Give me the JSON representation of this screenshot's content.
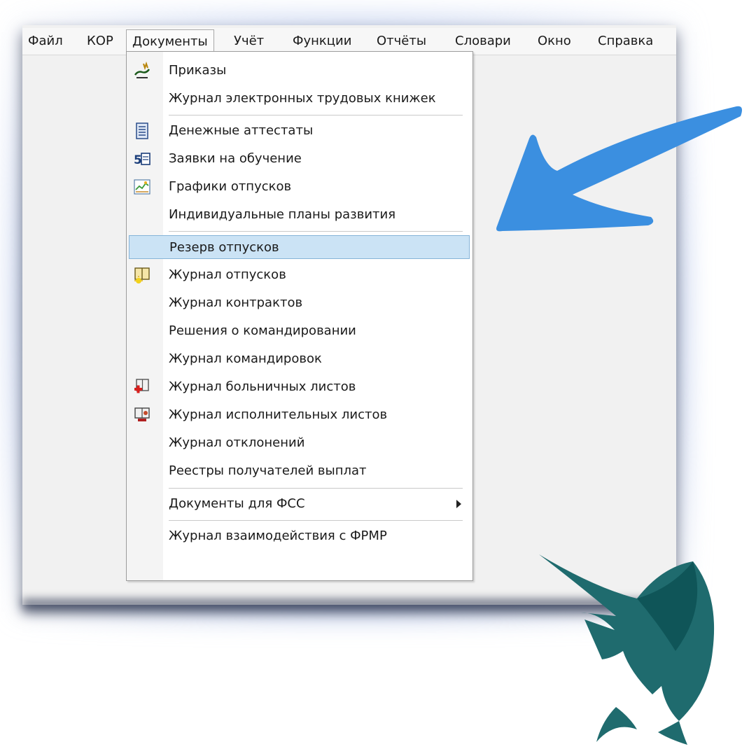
{
  "menubar": {
    "items": [
      "Файл",
      "КОР",
      "Документы",
      "Учёт",
      "Функции",
      "Отчёты",
      "Словари",
      "Окно",
      "Справка"
    ],
    "active_index": 2
  },
  "menu": {
    "items": [
      {
        "label": "Приказы",
        "icon": "orders-icon"
      },
      {
        "label": "Журнал электронных трудовых книжек",
        "icon": ""
      },
      {
        "label": "Денежные аттестаты",
        "icon": "attestat-icon"
      },
      {
        "label": "Заявки на обучение",
        "icon": "training-icon"
      },
      {
        "label": "Графики отпусков",
        "icon": "vacation-chart-icon"
      },
      {
        "label": "Индивидуальные планы развития",
        "icon": ""
      },
      {
        "label": "Резерв отпусков",
        "icon": "",
        "highlighted": true
      },
      {
        "label": "Журнал отпусков",
        "icon": "vacation-journal-icon"
      },
      {
        "label": "Журнал контрактов",
        "icon": ""
      },
      {
        "label": "Решения о командировании",
        "icon": ""
      },
      {
        "label": "Журнал командировок",
        "icon": ""
      },
      {
        "label": "Журнал больничных листов",
        "icon": "sick-leave-icon"
      },
      {
        "label": "Журнал исполнительных листов",
        "icon": "writs-icon"
      },
      {
        "label": "Журнал отклонений",
        "icon": ""
      },
      {
        "label": "Реестры получателей выплат",
        "icon": ""
      },
      {
        "label": "Документы для ФСС",
        "icon": "",
        "submenu": true
      },
      {
        "label": "Журнал взаимодействия с ФРМР",
        "icon": ""
      }
    ]
  },
  "colors": {
    "highlight_bg": "#cbe3f5",
    "arrow": "#3b8fe0",
    "logo": "#1f6b6e"
  }
}
